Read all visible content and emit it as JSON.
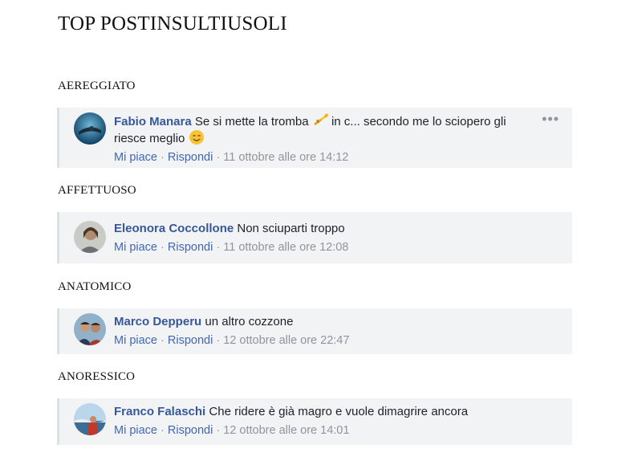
{
  "page": {
    "title": "TOP POSTINSULTIUSOLI"
  },
  "sections": [
    {
      "label": "AEREGGIATO",
      "comment": {
        "author": "Fabio Manara",
        "text_part1": "Se si mette la tromba",
        "text_part2": "in c... secondo me lo sciopero gli",
        "text_line2": "riesce meglio",
        "like": "Mi piace",
        "reply": "Rispondi",
        "sep": "·",
        "timestamp": "11 ottobre alle ore 14:12",
        "icons": [
          "trumpet-icon",
          "smiling-face-icon",
          "more-options-icon"
        ]
      }
    },
    {
      "label": "AFFETTUOSO",
      "comment": {
        "author": "Eleonora Coccollone",
        "text": "Non sciuparti troppo",
        "like": "Mi piace",
        "reply": "Rispondi",
        "sep": "·",
        "timestamp": "11 ottobre alle ore 12:08"
      }
    },
    {
      "label": "ANATOMICO",
      "comment": {
        "author": "Marco Depperu",
        "text": "un altro cozzone",
        "like": "Mi piace",
        "reply": "Rispondi",
        "sep": "·",
        "timestamp": "12 ottobre alle ore 22:47"
      }
    },
    {
      "label": "ANORESSICO",
      "comment": {
        "author": "Franco Falaschi",
        "text": "Che ridere è già magro e vuole dimagrire ancora",
        "like": "Mi piace",
        "reply": "Rispondi",
        "sep": "·",
        "timestamp": "12 ottobre alle ore 14:01"
      }
    }
  ],
  "colors": {
    "author": "#365899",
    "link": "#4267b2",
    "meta": "#90949c",
    "box": "#f2f3f5"
  }
}
